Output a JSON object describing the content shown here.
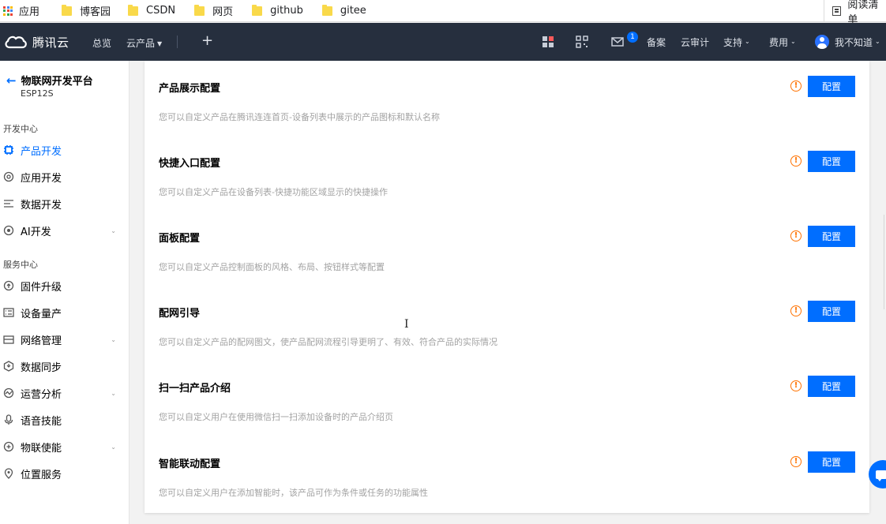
{
  "bookmarks": {
    "apps_label": "应用",
    "folders": [
      "博客园",
      "CSDN",
      "网页",
      "github",
      "gitee"
    ],
    "reading_list": "阅读清单"
  },
  "topnav": {
    "brand": "腾讯云",
    "overview": "总览",
    "products": "云产品",
    "plus": "+",
    "notification_count": "1",
    "filing": "备案",
    "cloud_audit": "云审计",
    "support": "支持",
    "billing": "费用",
    "username": "我不知道"
  },
  "sidebar": {
    "platform_title": "物联网开发平台",
    "device_name": "ESP12S",
    "section_dev": "开发中心",
    "section_service": "服务中心",
    "dev_items": [
      {
        "label": "产品开发",
        "icon": "chip-icon",
        "active": true
      },
      {
        "label": "应用开发",
        "icon": "app-gear-icon"
      },
      {
        "label": "数据开发",
        "icon": "data-flow-icon"
      },
      {
        "label": "AI开发",
        "icon": "ai-eye-icon",
        "expandable": true
      }
    ],
    "service_items": [
      {
        "label": "固件升级",
        "icon": "firmware-icon"
      },
      {
        "label": "设备量产",
        "icon": "list-icon"
      },
      {
        "label": "网络管理",
        "icon": "network-icon",
        "expandable": true
      },
      {
        "label": "数据同步",
        "icon": "sync-icon"
      },
      {
        "label": "运营分析",
        "icon": "analytics-icon",
        "expandable": true
      },
      {
        "label": "语音技能",
        "icon": "microphone-icon"
      },
      {
        "label": "物联使能",
        "icon": "enable-icon",
        "expandable": true
      },
      {
        "label": "位置服务",
        "icon": "location-pin-icon"
      }
    ]
  },
  "config_rows": [
    {
      "title": "产品展示配置",
      "desc": "您可以自定义产品在腾讯连连首页-设备列表中展示的产品图标和默认名称",
      "button": "配置"
    },
    {
      "title": "快捷入口配置",
      "desc": "您可以自定义产品在设备列表-快捷功能区域显示的快捷操作",
      "button": "配置"
    },
    {
      "title": "面板配置",
      "desc": "您可以自定义产品控制面板的风格、布局、按钮样式等配置",
      "button": "配置"
    },
    {
      "title": "配网引导",
      "desc": "您可以自定义产品的配网图文，使产品配网流程引导更明了、有效、符合产品的实际情况",
      "button": "配置"
    },
    {
      "title": "扫一扫产品介绍",
      "desc": "您可以自定义用户在使用微信扫一扫添加设备时的产品介绍页",
      "button": "配置"
    },
    {
      "title": "智能联动配置",
      "desc": "您可以自定义用户在添加智能时，该产品可作为条件或任务的功能属性",
      "button": "配置"
    }
  ],
  "colors": {
    "accent": "#006eff",
    "warning": "#ff7200",
    "nav_bg": "#262f3e"
  }
}
